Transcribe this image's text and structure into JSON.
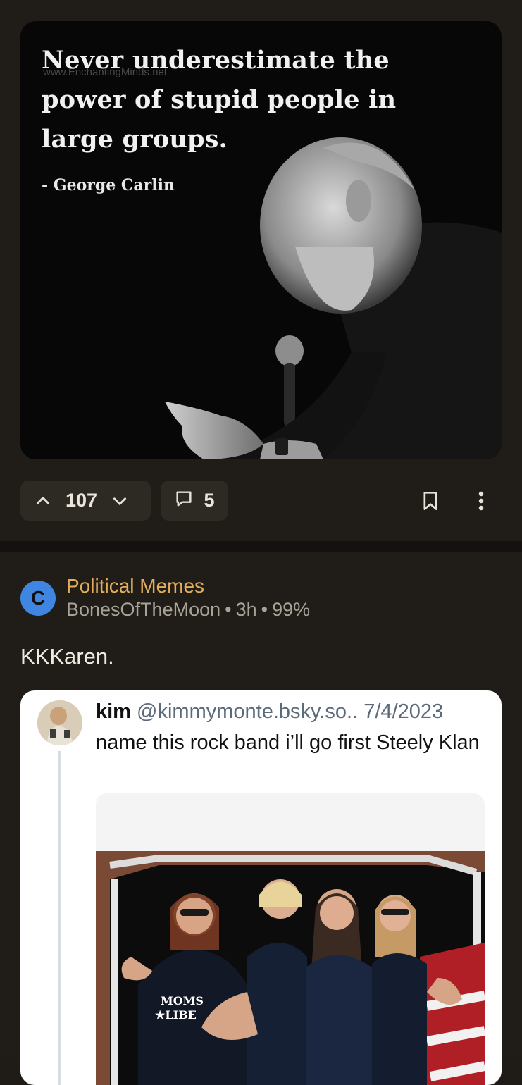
{
  "post1": {
    "image": {
      "quote": "Never underestimate the power of stupid people in large groups.",
      "author": "- George Carlin",
      "watermark": "www.EnchantingMinds.net"
    },
    "actions": {
      "upvote_icon": "chevron-up-icon",
      "score": "107",
      "downvote_icon": "chevron-down-icon",
      "comment_icon": "comment-icon",
      "comment_count": "5",
      "bookmark_icon": "bookmark-icon",
      "more_icon": "more-vertical-icon"
    }
  },
  "post2": {
    "avatar_letter": "C",
    "community": "Political Memes",
    "author": "BonesOfTheMoon",
    "age": "3h",
    "upvote_ratio": "99%",
    "title": "KKKaren.",
    "embed": {
      "name": "kim",
      "handle": "@kimmymonte.bsky.so..",
      "date": "7/4/2023",
      "text": "name this rock band i’ll go first Steely Klan",
      "shirt_text_1": "MOMS",
      "shirt_text_2": "LIBE"
    }
  },
  "colors": {
    "background": "#201c17",
    "pill": "#2d2a24",
    "community": "#e3ae5b",
    "avatar": "#3f86e2"
  }
}
